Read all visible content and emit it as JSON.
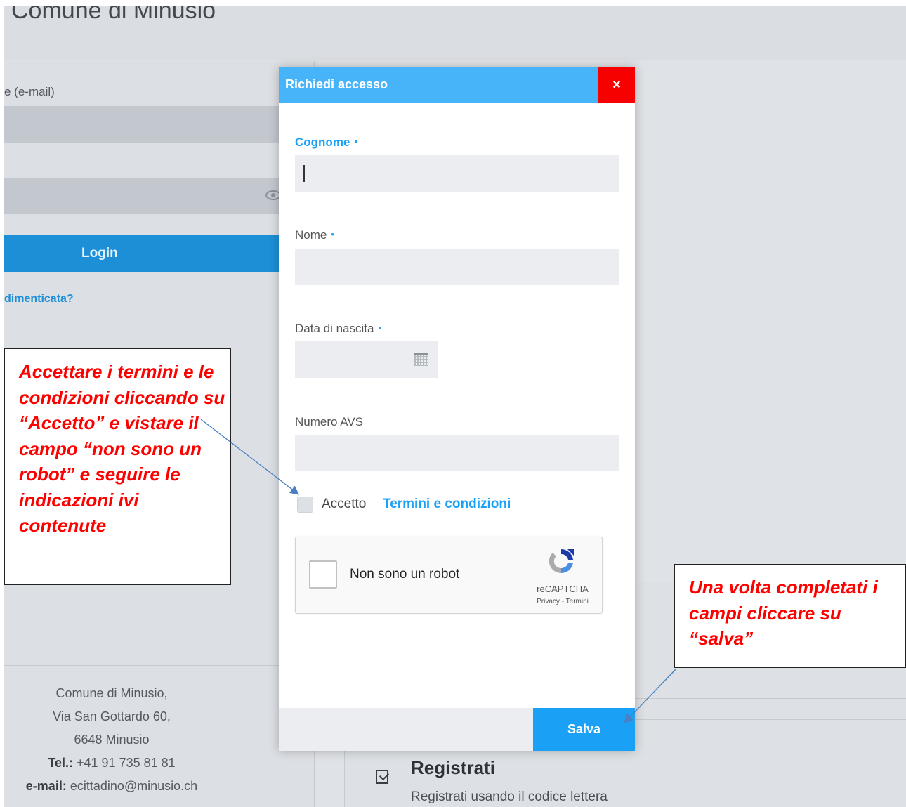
{
  "background": {
    "site_title": "Comune di Minusio",
    "email_label": "e (e-mail)",
    "login_label": "Login",
    "forgot_label": "dimenticata?",
    "footer": {
      "line1": "Comune di Minusio,",
      "line2": "Via San Gottardo 60,",
      "line3": "6648 Minusio",
      "tel_label": "Tel.:",
      "tel_value": " +41 91 735 81 81",
      "email_label": "e-mail:",
      "email_value": " ecittadino@minusio.ch"
    },
    "register": {
      "title": "Registrati",
      "subtitle": "Registrati usando il codice lettera"
    }
  },
  "modal": {
    "title": "Richiedi accesso",
    "close_label": "×",
    "fields": {
      "cognome": {
        "label": "Cognome",
        "required_mark": "•",
        "value": ""
      },
      "nome": {
        "label": "Nome",
        "required_mark": "•",
        "value": ""
      },
      "data_nascita": {
        "label": "Data di nascita",
        "required_mark": "•",
        "value": ""
      },
      "numero_avs": {
        "label": "Numero AVS",
        "value": ""
      }
    },
    "accept": {
      "label": "Accetto",
      "link": "Termini e condizioni",
      "checked": false
    },
    "recaptcha": {
      "text": "Non sono un robot",
      "brand": "reCAPTCHA",
      "privacy": "Privacy",
      "separator": " - ",
      "terms": "Termini"
    },
    "save_label": "Salva"
  },
  "annotations": {
    "left": "Accettare i termini e le condizioni cliccando su “Accetto” e vistare il campo “non sono un robot” e seguire le indicazioni ivi contenute",
    "right": "Una volta completati i campi cliccare su “salva”"
  },
  "colors": {
    "header_blue": "#47b3f8",
    "close_red": "#f70000",
    "accent_blue": "#1aa1f5",
    "annotation_red": "#ff0000",
    "arrow_blue": "#4a7fc1"
  }
}
